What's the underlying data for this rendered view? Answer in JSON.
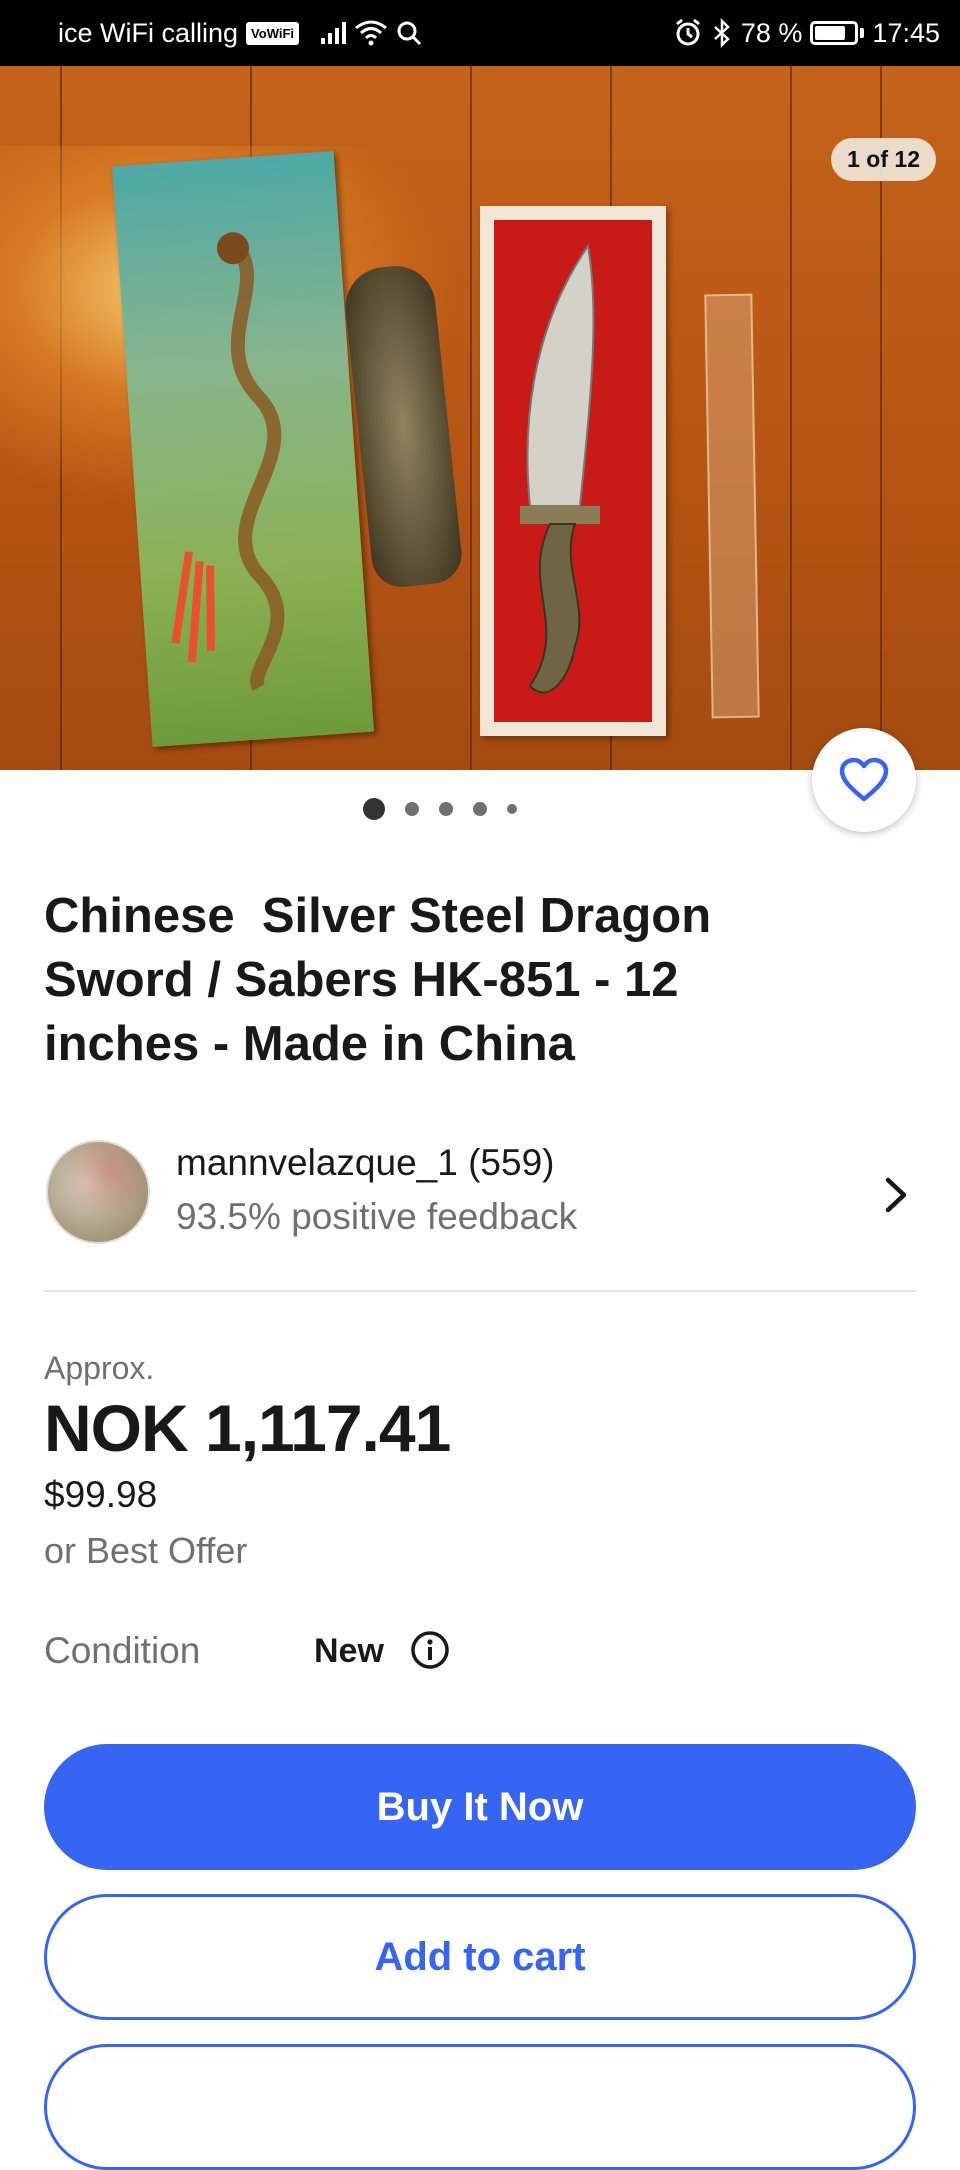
{
  "status_bar": {
    "carrier": "ice WiFi calling",
    "vowifi_badge": "VoWiFi",
    "battery": "78 %",
    "battery_level": 0.78,
    "time": "17:45"
  },
  "gallery": {
    "counter": "1 of 12",
    "dots_total": 5,
    "dots_active_index": 0
  },
  "listing": {
    "title": "Chinese  Silver Steel Dragon Sword / Sabers HK-851 - 12 inches - Made in China"
  },
  "seller": {
    "name": "mannvelazque_1 (559)",
    "feedback": "93.5% positive feedback"
  },
  "price": {
    "approx_label": "Approx.",
    "local": "NOK 1,117.41",
    "original": "$99.98",
    "best_offer": "or Best Offer"
  },
  "condition": {
    "label": "Condition",
    "value": "New"
  },
  "actions": {
    "buy_now": "Buy It Now",
    "add_to_cart": "Add to cart"
  },
  "colors": {
    "accent": "#3665f3",
    "text_primary": "#191919",
    "text_secondary": "#707070"
  }
}
